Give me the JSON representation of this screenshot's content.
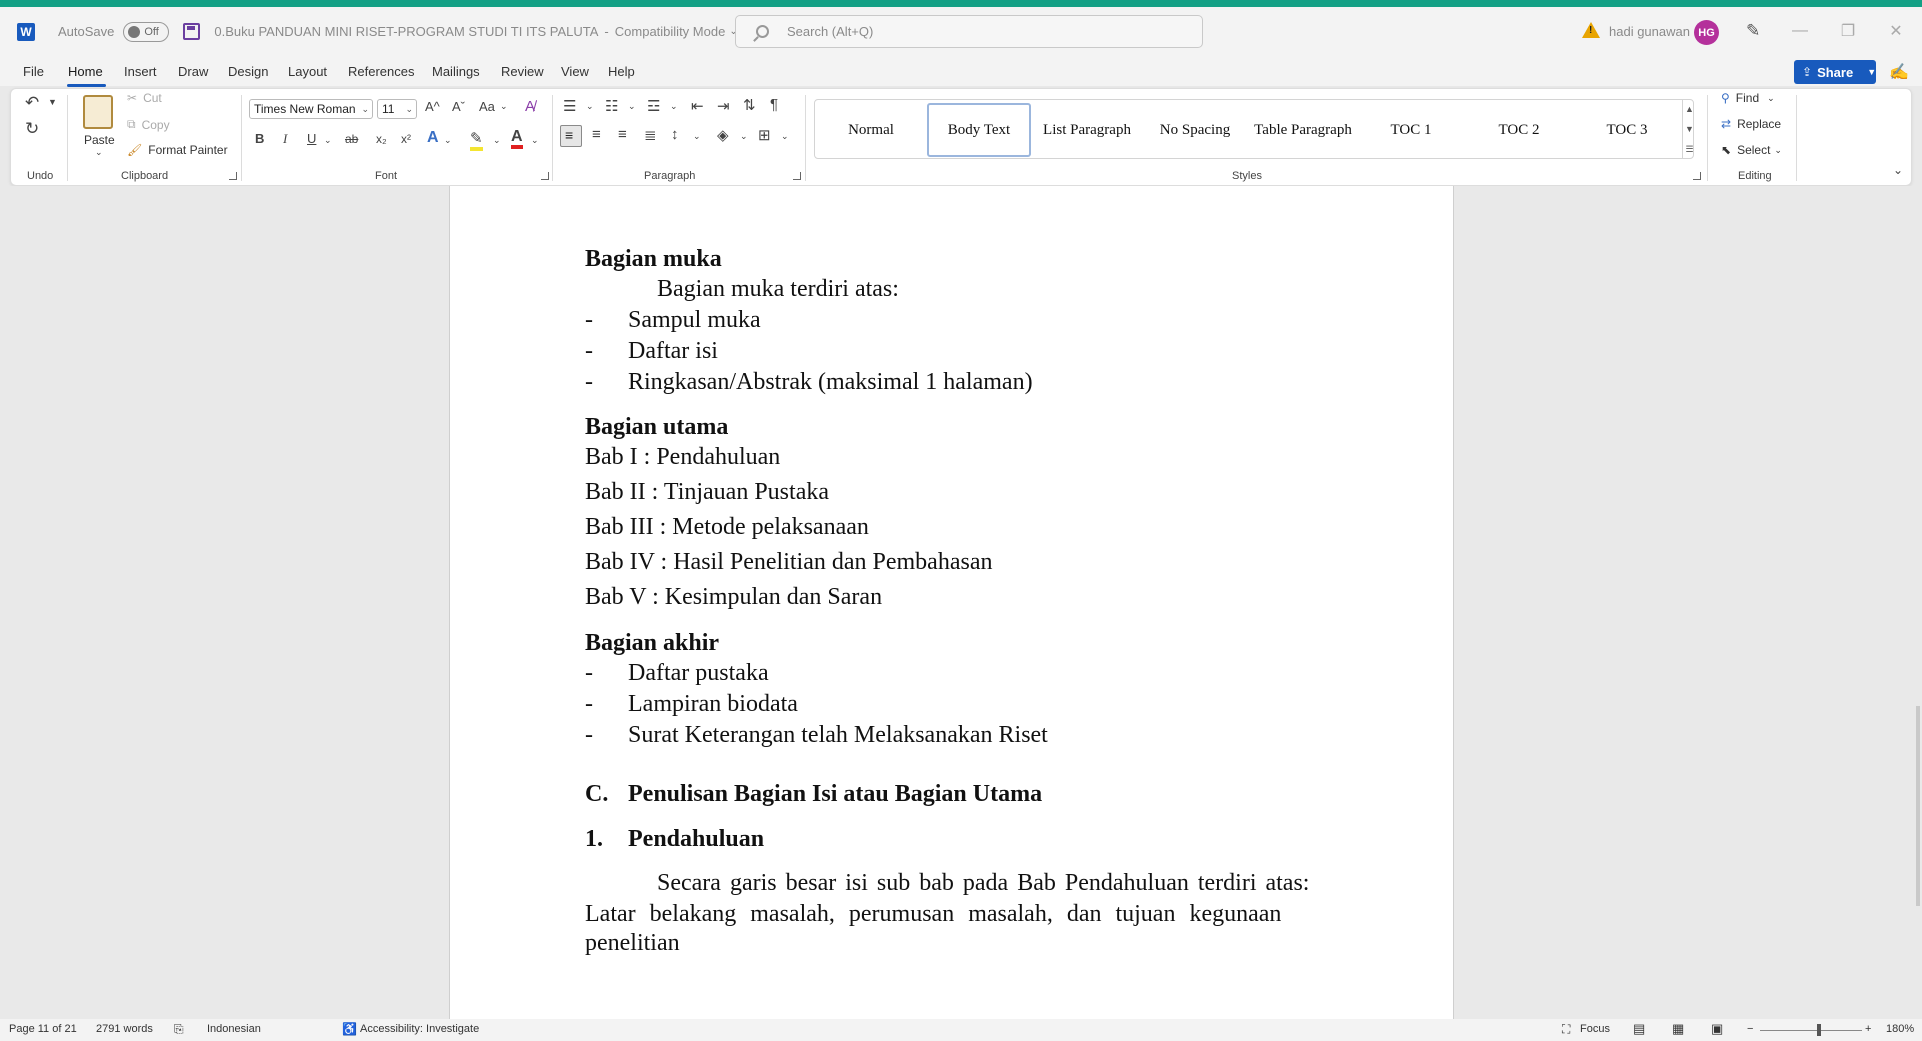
{
  "app": {
    "autosave_label": "AutoSave",
    "autosave_state": "Off",
    "document_title": "0.Buku PANDUAN MINI RISET-PROGRAM STUDI TI ITS PALUTA",
    "mode_separator": "-",
    "document_mode": "Compatibility Mode",
    "search_placeholder": "Search (Alt+Q)",
    "user_name": "hadi gunawan",
    "user_initials": "HG",
    "accent_color": "#13a085",
    "brand_color": "#185abd"
  },
  "menu": {
    "tabs": [
      "File",
      "Home",
      "Insert",
      "Draw",
      "Design",
      "Layout",
      "References",
      "Mailings",
      "Review",
      "View",
      "Help"
    ],
    "active_tab": "Home",
    "share_label": "Share"
  },
  "ribbon": {
    "groups": {
      "undo": "Undo",
      "clipboard": "Clipboard",
      "font": "Font",
      "paragraph": "Paragraph",
      "styles": "Styles",
      "editing": "Editing"
    },
    "clipboard": {
      "paste": "Paste",
      "cut": "Cut",
      "copy": "Copy",
      "format_painter": "Format Painter"
    },
    "font": {
      "font_name": "Times New Roman",
      "font_size": "11",
      "bold": "B",
      "italic": "I",
      "underline": "U",
      "strikethrough": "ab",
      "subscript": "x₂",
      "superscript": "x²",
      "change_case": "Aa",
      "grow": "A^",
      "shrink": "Aˇ"
    },
    "styles": [
      "Normal",
      "Body Text",
      "List Paragraph",
      "No Spacing",
      "Table Paragraph",
      "TOC 1",
      "TOC 2",
      "TOC 3"
    ],
    "selected_style": "Body Text",
    "editing": {
      "find": "Find",
      "replace": "Replace",
      "select": "Select"
    }
  },
  "document": {
    "lines": [
      "Bagian muka",
      "Bagian muka terdiri atas:",
      "Sampul muka",
      "Daftar isi",
      "Ringkasan/Abstrak (maksimal 1 halaman)",
      "Bagian utama",
      "Bab I : Pendahuluan",
      "Bab II : Tinjauan Pustaka",
      "Bab III : Metode pelaksanaan",
      "Bab IV : Hasil Penelitian dan Pembahasan",
      "Bab V  : Kesimpulan dan Saran",
      "Bagian akhir",
      "Daftar pustaka",
      "Lampiran biodata",
      "Surat Keterangan telah Melaksanakan Riset",
      "C.",
      "Penulisan Bagian Isi atau Bagian Utama",
      "1.",
      "Pendahuluan",
      "Secara garis besar isi sub bab pada Bab Pendahuluan terdiri atas:",
      "Latar belakang masalah, perumusan masalah, dan tujuan kegunaan",
      "penelitian"
    ],
    "bullet": "-"
  },
  "status": {
    "page": "Page 11 of 21",
    "words": "2791 words",
    "language": "Indonesian",
    "accessibility": "Accessibility: Investigate",
    "focus": "Focus",
    "zoom": "180%"
  }
}
